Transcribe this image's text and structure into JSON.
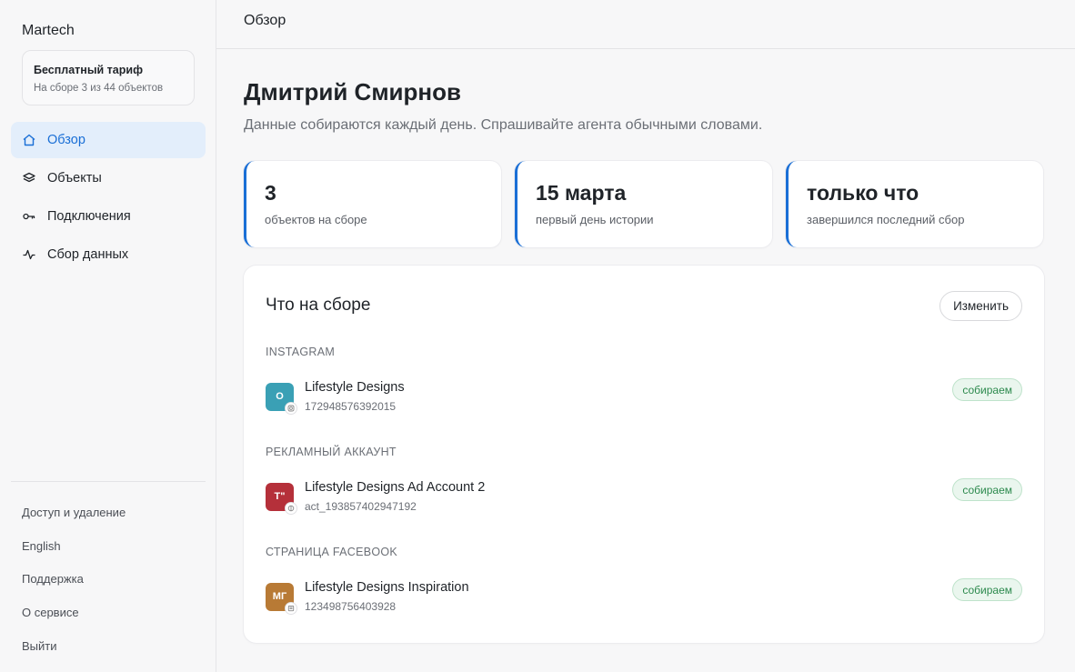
{
  "brand": "Martech",
  "plan": {
    "title": "Бесплатный тариф",
    "subtitle": "На сборе 3 из 44 объектов"
  },
  "nav": [
    {
      "label": "Обзор",
      "icon": "home-icon",
      "active": true
    },
    {
      "label": "Объекты",
      "icon": "layers-icon",
      "active": false
    },
    {
      "label": "Подключения",
      "icon": "key-icon",
      "active": false
    },
    {
      "label": "Сбор данных",
      "icon": "activity-icon",
      "active": false
    }
  ],
  "footer": [
    "Доступ и удаление",
    "English",
    "Поддержка",
    "О сервисе",
    "Выйти"
  ],
  "topbar": {
    "title": "Обзор"
  },
  "page": {
    "title": "Дмитрий Смирнов",
    "subtitle": "Данные собираются каждый день. Спрашивайте агента обычными словами."
  },
  "stats": [
    {
      "value": "3",
      "label": "объектов на сборе"
    },
    {
      "value": "15 марта",
      "label": "первый день истории"
    },
    {
      "value": "только что",
      "label": "завершился последний сбор"
    }
  ],
  "card": {
    "title": "Что на сборе",
    "edit_label": "Изменить",
    "groups": [
      {
        "label": "INSTAGRAM",
        "items": [
          {
            "initials": "O",
            "color": "#3aa0b5",
            "badge": "instagram-icon",
            "name": "Lifestyle Designs",
            "id": "172948576392015",
            "status": "собираем"
          }
        ]
      },
      {
        "label": "РЕКЛАМНЫЙ АККАУНТ",
        "items": [
          {
            "initials": "T\"",
            "color": "#b5303a",
            "badge": "ad-account-icon",
            "name": "Lifestyle Designs Ad Account 2",
            "id": "act_193857402947192",
            "status": "собираем"
          }
        ]
      },
      {
        "label": "СТРАНИЦА FACEBOOK",
        "items": [
          {
            "initials": "МГ",
            "color": "#b87a35",
            "badge": "page-icon",
            "name": "Lifestyle Designs Inspiration",
            "id": "123498756403928",
            "status": "собираем"
          }
        ]
      }
    ]
  },
  "colors": {
    "accent": "#1a6fd6",
    "active_bg": "#e3eefb",
    "status_green": "#2d8a4e"
  }
}
